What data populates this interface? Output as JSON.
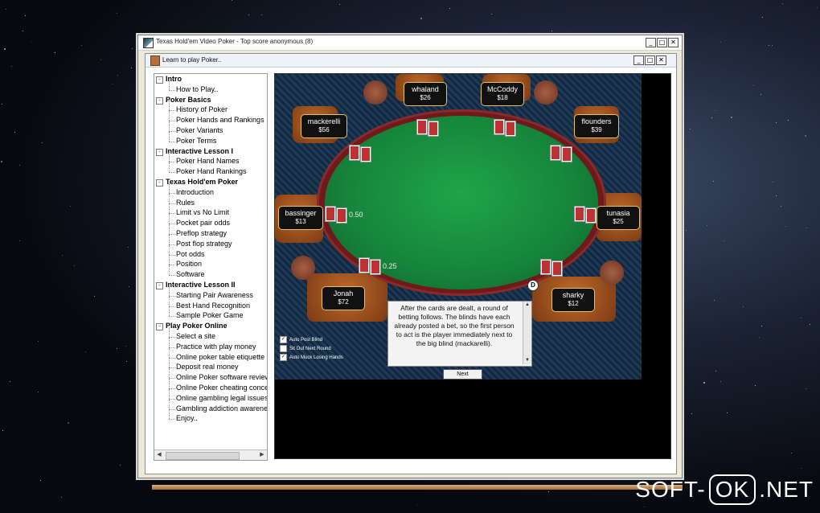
{
  "app": {
    "window_title": "Texas Hold'em Video Poker -   Top score anonymous (8)",
    "inner_title": "Learn to play Poker.."
  },
  "window_buttons": [
    "_",
    "□",
    "✕"
  ],
  "tree": [
    {
      "label": "Intro",
      "category": true
    },
    {
      "label": "How to Play..",
      "category": false
    },
    {
      "label": "Poker Basics",
      "category": true
    },
    {
      "label": "History of Poker",
      "category": false
    },
    {
      "label": "Poker Hands and Rankings",
      "category": false
    },
    {
      "label": "Poker Variants",
      "category": false
    },
    {
      "label": "Poker Terms",
      "category": false
    },
    {
      "label": "Interactive Lesson I",
      "category": true
    },
    {
      "label": "Poker Hand Names",
      "category": false
    },
    {
      "label": "Poker Hand Rankings",
      "category": false
    },
    {
      "label": "Texas Hold'em Poker",
      "category": true
    },
    {
      "label": "Introduction",
      "category": false
    },
    {
      "label": "Rules",
      "category": false
    },
    {
      "label": "Limit vs No Limit",
      "category": false
    },
    {
      "label": "Pocket pair odds",
      "category": false
    },
    {
      "label": "Preflop strategy",
      "category": false
    },
    {
      "label": "Post flop strategy",
      "category": false
    },
    {
      "label": "Pot odds",
      "category": false
    },
    {
      "label": "Position",
      "category": false
    },
    {
      "label": "Software",
      "category": false
    },
    {
      "label": "Interactive Lesson II",
      "category": true
    },
    {
      "label": "Starting Pair Awareness",
      "category": false
    },
    {
      "label": "Best Hand Recognition",
      "category": false
    },
    {
      "label": "Sample Poker Game",
      "category": false
    },
    {
      "label": "Play Poker Online",
      "category": true
    },
    {
      "label": "Select a site",
      "category": false
    },
    {
      "label": "Practice with play money",
      "category": false
    },
    {
      "label": "Online poker table etiquette",
      "category": false
    },
    {
      "label": "Deposit real money",
      "category": false
    },
    {
      "label": "Online Poker software review",
      "category": false
    },
    {
      "label": "Online Poker cheating concerns",
      "category": false
    },
    {
      "label": "Online gambling legal issues",
      "category": false
    },
    {
      "label": "Gambling addiction awareness",
      "category": false
    },
    {
      "label": "Enjoy..",
      "category": false
    }
  ],
  "players": [
    {
      "name": "whaland",
      "cash": "$26"
    },
    {
      "name": "McCoddy",
      "cash": "$18"
    },
    {
      "name": "mackerelli",
      "cash": "$56"
    },
    {
      "name": "flounders",
      "cash": "$39"
    },
    {
      "name": "bassinger",
      "cash": "$13"
    },
    {
      "name": "tunasia",
      "cash": "$25"
    },
    {
      "name": "Jonah",
      "cash": "$72"
    },
    {
      "name": "sharky",
      "cash": "$12"
    }
  ],
  "bets": {
    "big_blind": "0.50",
    "small_blind": "0.25"
  },
  "dealer_button": "D",
  "options": [
    {
      "label": "Auto Post Blind",
      "checked": true
    },
    {
      "label": "Sit Out Next Round",
      "checked": false
    },
    {
      "label": "Auto Muck Losing Hands",
      "checked": true
    }
  ],
  "message": "After the cards are dealt, a round of betting follows. The blinds have each already posted a bet, so the first person to act is the player immediately next to the big blind (mackarelli).",
  "next_button": "Next",
  "watermark": {
    "left": "SOFT-",
    "mid": "OK",
    "right": ".NET"
  }
}
